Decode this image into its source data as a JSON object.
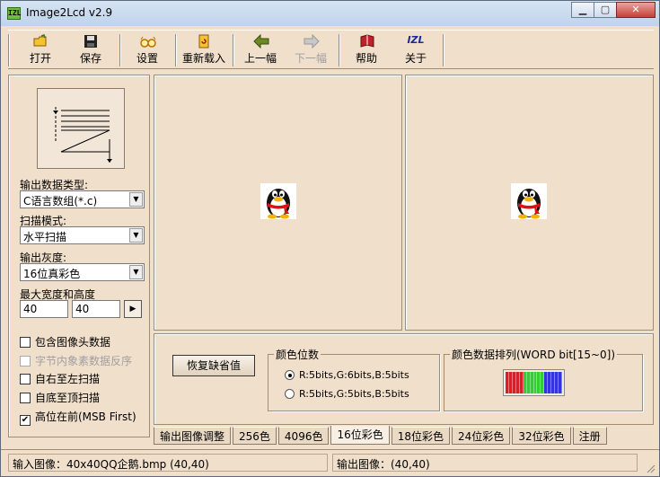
{
  "window": {
    "app_icon": "IZL",
    "title": "Image2Lcd v2.9",
    "min": "▁",
    "max": "▢",
    "close": "✕"
  },
  "toolbar": {
    "open": "打开",
    "save": "保存",
    "settings": "设置",
    "reload": "重新载入",
    "prev": "上一幅",
    "next": "下一幅",
    "help": "帮助",
    "about": "关于",
    "about_icon_text": "IZL"
  },
  "left": {
    "output_type_label": "输出数据类型:",
    "output_type_value": "C语言数组(*.c)",
    "scan_mode_label": "扫描模式:",
    "scan_mode_value": "水平扫描",
    "gray_label": "输出灰度:",
    "gray_value": "16位真彩色",
    "size_label": "最大宽度和高度",
    "max_width": "40",
    "max_height": "40",
    "checkboxes": [
      {
        "label": "包含图像头数据",
        "checked": false,
        "enabled": true
      },
      {
        "label": "字节内象素数据反序",
        "checked": false,
        "enabled": false
      },
      {
        "label": "自右至左扫描",
        "checked": false,
        "enabled": true
      },
      {
        "label": "自底至顶扫描",
        "checked": false,
        "enabled": true
      },
      {
        "label": "高位在前(MSB First)",
        "checked": true,
        "enabled": true
      }
    ]
  },
  "bottom": {
    "restore_default": "恢复缺省值",
    "color_bits_group": "颜色位数",
    "radio1": "R:5bits,G:6bits,B:5bits",
    "radio2": "R:5bits,G:5bits,B:5bits",
    "color_order_group": "颜色数据排列(WORD bit[15~0])",
    "color_bar": [
      "#e31b23",
      "#e31b23",
      "#e31b23",
      "#e31b23",
      "#e31b23",
      "#33cc33",
      "#33cc33",
      "#33cc33",
      "#33cc33",
      "#33cc33",
      "#33cc33",
      "#3333dd",
      "#3333dd",
      "#3333dd",
      "#3333dd",
      "#3333dd"
    ]
  },
  "tabs": [
    "输出图像调整",
    "256色",
    "4096色",
    "16位彩色",
    "18位彩色",
    "24位彩色",
    "32位彩色",
    "注册"
  ],
  "active_tab": "16位彩色",
  "status": {
    "input": "输入图像：40x40QQ企鹅.bmp (40,40)",
    "output": "输出图像：(40,40)"
  },
  "icons": {
    "open": "folder-open-icon",
    "save": "floppy-icon",
    "settings": "glasses-icon",
    "reload": "reload-icon",
    "prev": "arrow-left-icon",
    "next": "arrow-right-icon",
    "help": "book-icon",
    "about": "logo-icon"
  }
}
